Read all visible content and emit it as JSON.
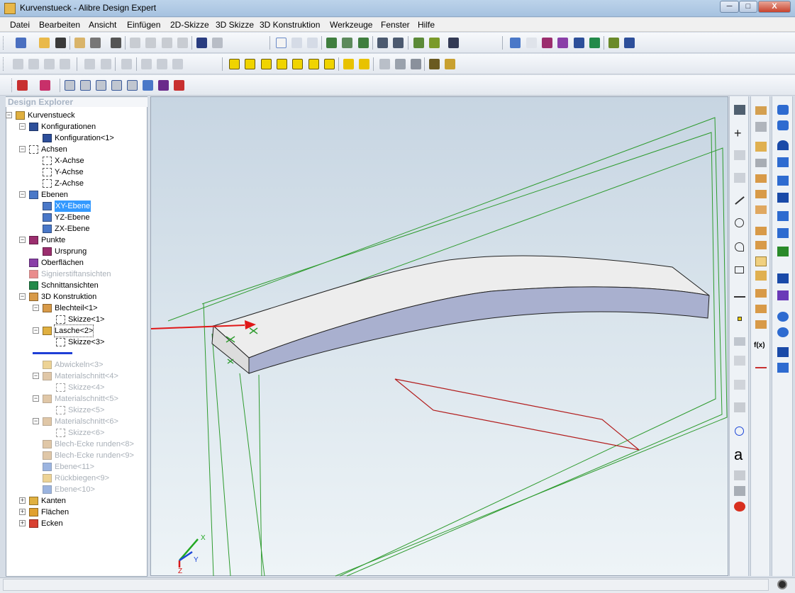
{
  "window": {
    "title": "Kurvenstueck - Alibre Design Expert",
    "minimize": "─",
    "maximize": "□",
    "close": "X"
  },
  "menu": [
    "Datei",
    "Bearbeiten",
    "Ansicht",
    "Einfügen",
    "2D-Skizze",
    "3D Skizze",
    "3D Konstruktion",
    "Werkzeuge",
    "Fenster",
    "Hilfe"
  ],
  "explorer": {
    "title": "Design Explorer",
    "items": [
      {
        "label": "Kurvenstueck",
        "level": 0,
        "toggle": "−",
        "icon": "part-icon"
      },
      {
        "label": "Konfigurationen",
        "level": 1,
        "toggle": "−",
        "icon": "table-icon"
      },
      {
        "label": "Konfiguration<1>",
        "level": 2,
        "toggle": "",
        "icon": "table-icon"
      },
      {
        "label": "Achsen",
        "level": 1,
        "toggle": "−",
        "icon": "axis-icon"
      },
      {
        "label": "X-Achse",
        "level": 2,
        "toggle": "",
        "icon": "axis-icon"
      },
      {
        "label": "Y-Achse",
        "level": 2,
        "toggle": "",
        "icon": "axis-icon"
      },
      {
        "label": "Z-Achse",
        "level": 2,
        "toggle": "",
        "icon": "axis-icon"
      },
      {
        "label": "Ebenen",
        "level": 1,
        "toggle": "−",
        "icon": "plane-icon"
      },
      {
        "label": "XY-Ebene",
        "level": 2,
        "toggle": "",
        "icon": "plane-icon",
        "state": "sel"
      },
      {
        "label": "YZ-Ebene",
        "level": 2,
        "toggle": "",
        "icon": "plane-icon"
      },
      {
        "label": "ZX-Ebene",
        "level": 2,
        "toggle": "",
        "icon": "plane-icon"
      },
      {
        "label": "Punkte",
        "level": 1,
        "toggle": "−",
        "icon": "point-icon"
      },
      {
        "label": "Ursprung",
        "level": 2,
        "toggle": "",
        "icon": "point-icon"
      },
      {
        "label": "Oberflächen",
        "level": 1,
        "toggle": "",
        "icon": "surface-icon"
      },
      {
        "label": "Signierstiftansichten",
        "level": 1,
        "toggle": "",
        "icon": "redline-icon",
        "state": "dim"
      },
      {
        "label": "Schnittansichten",
        "level": 1,
        "toggle": "",
        "icon": "section-icon"
      },
      {
        "label": "3D Konstruktion",
        "level": 1,
        "toggle": "−",
        "icon": "feature-icon"
      },
      {
        "label": "Blechteil<1>",
        "level": 2,
        "toggle": "−",
        "icon": "sheetmetal-icon"
      },
      {
        "label": "Skizze<1>",
        "level": 3,
        "toggle": "",
        "icon": "sketch-icon"
      },
      {
        "label": "Lasche<2>",
        "level": 2,
        "toggle": "−",
        "icon": "flange-icon",
        "state": "focus"
      },
      {
        "label": "Skizze<3>",
        "level": 3,
        "toggle": "",
        "icon": "sketch-icon"
      },
      {
        "label": "",
        "level": 2,
        "toggle": "",
        "icon": "rollback-bar-icon",
        "state": "rollback"
      },
      {
        "label": "Abwickeln<3>",
        "level": 2,
        "toggle": "",
        "icon": "unfold-icon",
        "state": "dim"
      },
      {
        "label": "Materialschnitt<4>",
        "level": 2,
        "toggle": "−",
        "icon": "cut-icon",
        "state": "dim"
      },
      {
        "label": "Skizze<4>",
        "level": 3,
        "toggle": "",
        "icon": "sketch-icon",
        "state": "dim"
      },
      {
        "label": "Materialschnitt<5>",
        "level": 2,
        "toggle": "−",
        "icon": "cut-icon",
        "state": "dim"
      },
      {
        "label": "Skizze<5>",
        "level": 3,
        "toggle": "",
        "icon": "sketch-icon",
        "state": "dim"
      },
      {
        "label": "Materialschnitt<6>",
        "level": 2,
        "toggle": "−",
        "icon": "cut-icon",
        "state": "dim"
      },
      {
        "label": "Skizze<6>",
        "level": 3,
        "toggle": "",
        "icon": "sketch-icon",
        "state": "dim"
      },
      {
        "label": "Blech-Ecke runden<8>",
        "level": 2,
        "toggle": "",
        "icon": "corner-icon",
        "state": "dim"
      },
      {
        "label": "Blech-Ecke runden<9>",
        "level": 2,
        "toggle": "",
        "icon": "corner-icon",
        "state": "dim"
      },
      {
        "label": "Ebene<11>",
        "level": 2,
        "toggle": "",
        "icon": "plane-icon",
        "state": "dim"
      },
      {
        "label": "Rückbiegen<9>",
        "level": 2,
        "toggle": "",
        "icon": "refold-icon",
        "state": "dim"
      },
      {
        "label": "Ebene<10>",
        "level": 2,
        "toggle": "",
        "icon": "plane-icon",
        "state": "dim"
      },
      {
        "label": "Kanten",
        "level": 1,
        "toggle": "+",
        "icon": "edges-icon"
      },
      {
        "label": "Flächen",
        "level": 1,
        "toggle": "+",
        "icon": "faces-icon"
      },
      {
        "label": "Ecken",
        "level": 1,
        "toggle": "+",
        "icon": "vertices-icon"
      }
    ]
  },
  "viewport": {
    "triad": {
      "x": "X",
      "y": "Y",
      "z": "Z"
    }
  },
  "palettes": {
    "sketch_text": "a",
    "fx": "f(x)"
  },
  "colors": {
    "wireframe": "#2e9b2e",
    "sketch_line": "#b21c1c",
    "arrow": "#e01818",
    "selection": "#3399ff",
    "rollback": "#1f3fd6"
  }
}
